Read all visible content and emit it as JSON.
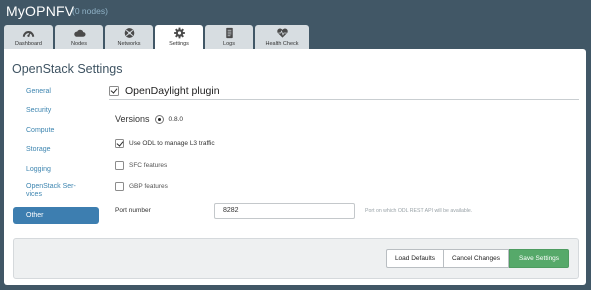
{
  "environment": {
    "name": "MyOPNFV",
    "nodes_label": "(0 nodes)"
  },
  "tabs": [
    {
      "label": "Dashboard",
      "icon": "dashboard-icon"
    },
    {
      "label": "Nodes",
      "icon": "cloud-icon"
    },
    {
      "label": "Networks",
      "icon": "network-icon"
    },
    {
      "label": "Settings",
      "icon": "gear-icon",
      "active": true
    },
    {
      "label": "Logs",
      "icon": "logs-icon"
    },
    {
      "label": "Health Check",
      "icon": "heart-icon"
    }
  ],
  "page": {
    "title": "OpenStack Settings"
  },
  "sidebar": {
    "items": [
      {
        "label": "General"
      },
      {
        "label": "Security"
      },
      {
        "label": "Compute"
      },
      {
        "label": "Storage"
      },
      {
        "label": "Logging"
      },
      {
        "label": "OpenStack Ser-\nvices"
      },
      {
        "label": "Other",
        "active": true
      }
    ]
  },
  "plugin": {
    "title": "OpenDaylight plugin",
    "enabled": true,
    "versions_label": "Versions",
    "version_value": "0.8.0",
    "options": [
      {
        "label": "Use ODL to manage L3 traffic",
        "checked": true
      },
      {
        "label": "SFC features",
        "checked": false
      },
      {
        "label": "GBP features",
        "checked": false
      }
    ],
    "port": {
      "label": "Port number",
      "value": "8282",
      "help": "Port on which ODL REST API will be available."
    }
  },
  "footer": {
    "load_defaults": "Load Defaults",
    "cancel_changes": "Cancel Changes",
    "save_settings": "Save Settings"
  },
  "colors": {
    "background": "#415766",
    "accent": "#3d7eb0",
    "save_button": "#56a96a"
  }
}
